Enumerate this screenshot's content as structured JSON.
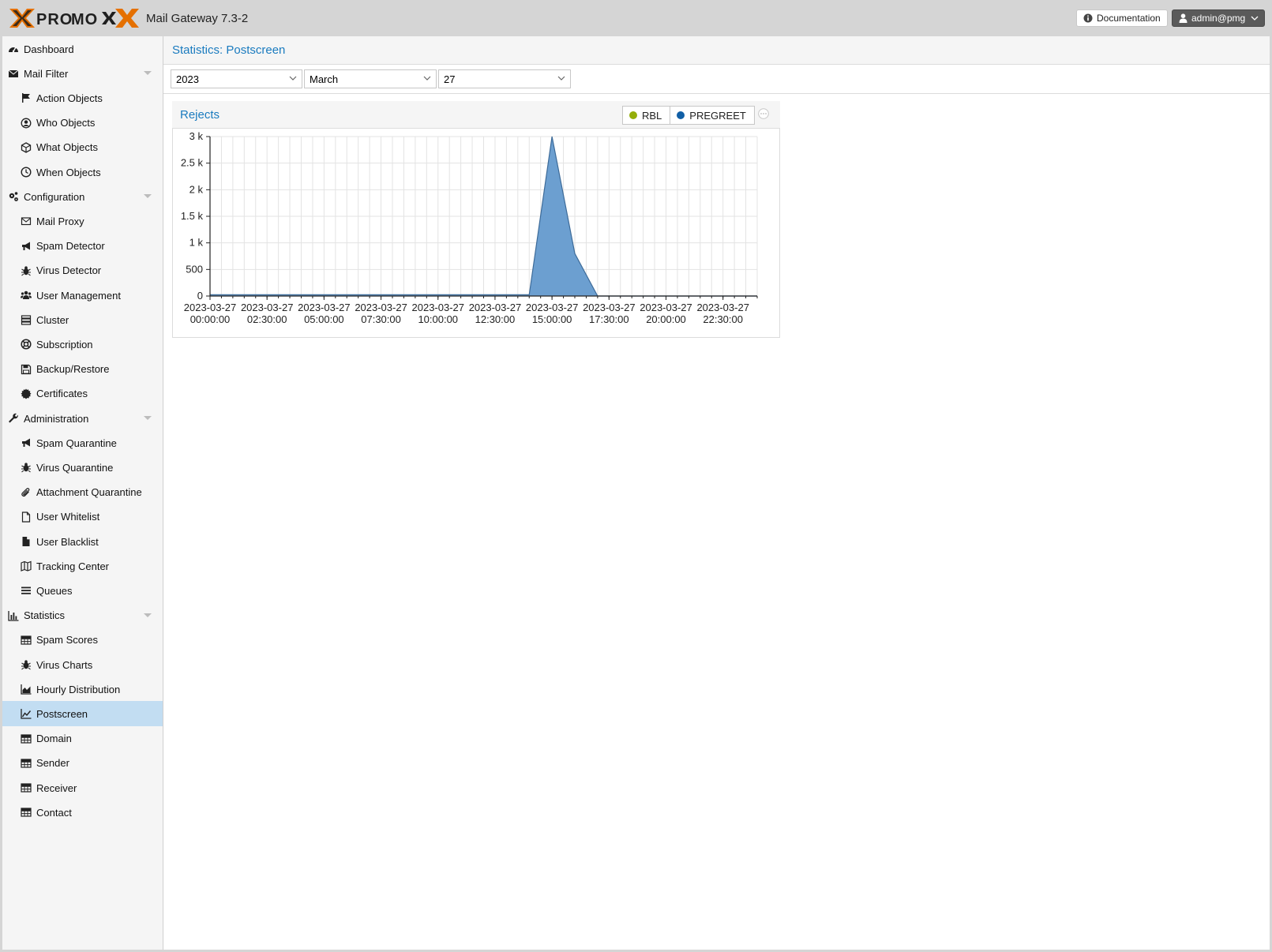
{
  "header": {
    "product": "Mail Gateway 7.3-2",
    "documentation": "Documentation",
    "user": "admin@pmg"
  },
  "sidebar": {
    "items": [
      {
        "label": "Dashboard",
        "level": 0,
        "icon": "tachometer-icon"
      },
      {
        "label": "Mail Filter",
        "level": 0,
        "icon": "envelope-icon",
        "expandable": true
      },
      {
        "label": "Action Objects",
        "level": 1,
        "icon": "flag-icon"
      },
      {
        "label": "Who Objects",
        "level": 1,
        "icon": "user-circle-icon"
      },
      {
        "label": "What Objects",
        "level": 1,
        "icon": "cube-icon"
      },
      {
        "label": "When Objects",
        "level": 1,
        "icon": "clock-icon"
      },
      {
        "label": "Configuration",
        "level": 0,
        "icon": "cogs-icon",
        "expandable": true
      },
      {
        "label": "Mail Proxy",
        "level": 1,
        "icon": "envelope-outline-icon"
      },
      {
        "label": "Spam Detector",
        "level": 1,
        "icon": "bullhorn-icon"
      },
      {
        "label": "Virus Detector",
        "level": 1,
        "icon": "bug-icon"
      },
      {
        "label": "User Management",
        "level": 1,
        "icon": "users-icon"
      },
      {
        "label": "Cluster",
        "level": 1,
        "icon": "server-icon"
      },
      {
        "label": "Subscription",
        "level": 1,
        "icon": "support-icon"
      },
      {
        "label": "Backup/Restore",
        "level": 1,
        "icon": "floppy-icon"
      },
      {
        "label": "Certificates",
        "level": 1,
        "icon": "certificate-icon"
      },
      {
        "label": "Administration",
        "level": 0,
        "icon": "wrench-icon",
        "expandable": true
      },
      {
        "label": "Spam Quarantine",
        "level": 1,
        "icon": "bullhorn-icon"
      },
      {
        "label": "Virus Quarantine",
        "level": 1,
        "icon": "bug-icon"
      },
      {
        "label": "Attachment Quarantine",
        "level": 1,
        "icon": "paperclip-icon"
      },
      {
        "label": "User Whitelist",
        "level": 1,
        "icon": "file-outline-icon"
      },
      {
        "label": "User Blacklist",
        "level": 1,
        "icon": "file-icon"
      },
      {
        "label": "Tracking Center",
        "level": 1,
        "icon": "map-icon"
      },
      {
        "label": "Queues",
        "level": 1,
        "icon": "bars-icon"
      },
      {
        "label": "Statistics",
        "level": 0,
        "icon": "bar-chart-icon",
        "expandable": true
      },
      {
        "label": "Spam Scores",
        "level": 1,
        "icon": "table-icon"
      },
      {
        "label": "Virus Charts",
        "level": 1,
        "icon": "bug-icon"
      },
      {
        "label": "Hourly Distribution",
        "level": 1,
        "icon": "area-chart-icon"
      },
      {
        "label": "Postscreen",
        "level": 1,
        "icon": "line-chart-icon",
        "selected": true
      },
      {
        "label": "Domain",
        "level": 1,
        "icon": "table-icon"
      },
      {
        "label": "Sender",
        "level": 1,
        "icon": "table-icon"
      },
      {
        "label": "Receiver",
        "level": 1,
        "icon": "table-icon"
      },
      {
        "label": "Contact",
        "level": 1,
        "icon": "table-icon"
      }
    ]
  },
  "main": {
    "title": "Statistics: Postscreen",
    "year": "2023",
    "month": "March",
    "day": "27",
    "panel_title": "Rejects"
  },
  "colors": {
    "accent": "#1a7bbf",
    "rbl": "#94ae0a",
    "pregreet": "#115fa6",
    "area": "#6c9fd0"
  },
  "chart_data": {
    "type": "area",
    "title": "Rejects",
    "ylim": [
      0,
      3000
    ],
    "yticks": [
      "0",
      "500",
      "1 k",
      "1.5 k",
      "2 k",
      "2.5 k",
      "3 k"
    ],
    "ytick_values": [
      0,
      500,
      1000,
      1500,
      2000,
      2500,
      3000
    ],
    "xtick_labels": [
      [
        "2023-03-27",
        "00:00:00"
      ],
      [
        "2023-03-27",
        "02:30:00"
      ],
      [
        "2023-03-27",
        "05:00:00"
      ],
      [
        "2023-03-27",
        "07:30:00"
      ],
      [
        "2023-03-27",
        "10:00:00"
      ],
      [
        "2023-03-27",
        "12:30:00"
      ],
      [
        "2023-03-27",
        "15:00:00"
      ],
      [
        "2023-03-27",
        "17:30:00"
      ],
      [
        "2023-03-27",
        "20:00:00"
      ],
      [
        "2023-03-27",
        "22:30:00"
      ]
    ],
    "x_hours": [
      0,
      1,
      2,
      3,
      4,
      5,
      6,
      7,
      8,
      9,
      10,
      11,
      12,
      13,
      14,
      15,
      16,
      17,
      18,
      19,
      20,
      21,
      22,
      23,
      24
    ],
    "series": [
      {
        "name": "RBL",
        "values": [
          0,
          0,
          0,
          0,
          0,
          0,
          0,
          0,
          0,
          0,
          0,
          0,
          0,
          0,
          0,
          0,
          0,
          0,
          0,
          0,
          0,
          0,
          0,
          0,
          0
        ]
      },
      {
        "name": "PREGREET",
        "values": [
          25,
          25,
          25,
          25,
          25,
          25,
          25,
          25,
          25,
          25,
          25,
          25,
          25,
          25,
          25,
          3000,
          800,
          0,
          0,
          0,
          0,
          0,
          0,
          0,
          0
        ]
      }
    ],
    "legend_position": "top-right",
    "grid": true
  }
}
